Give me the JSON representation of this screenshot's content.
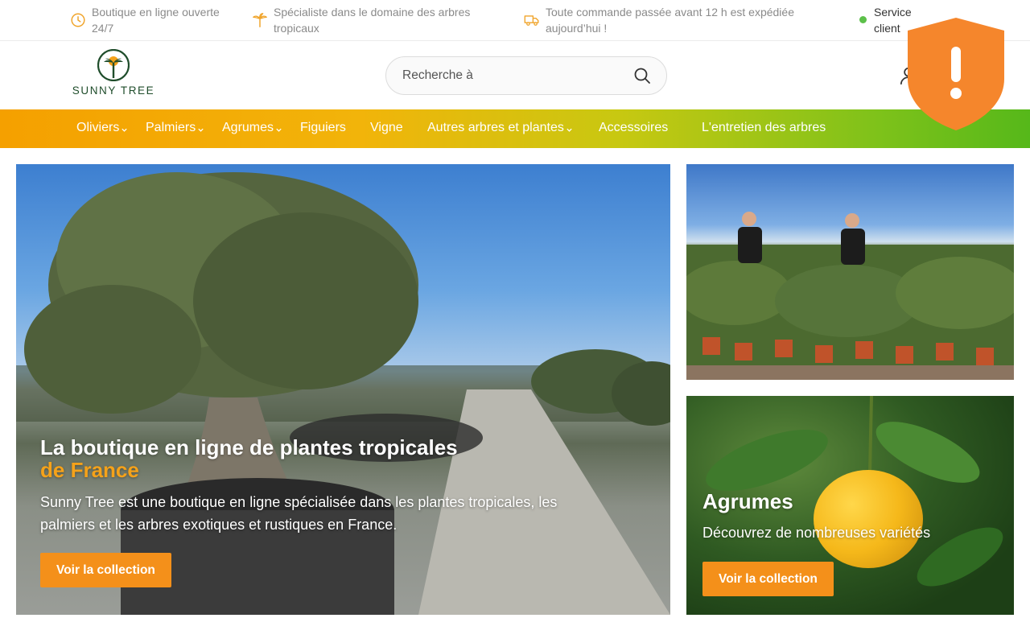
{
  "topbar": {
    "items": [
      {
        "icon": "clock-icon",
        "text": "Boutique en ligne ouverte 24/7"
      },
      {
        "icon": "palm-icon",
        "text": "Spécialiste dans le domaine des arbres tropicaux"
      },
      {
        "icon": "truck-icon",
        "text": "Toute commande passée avant 12 h est expédiée aujourd’hui !"
      },
      {
        "icon": "online-dot",
        "text": "Service client"
      }
    ]
  },
  "header": {
    "logo_text": "SUNNY TREE",
    "search_placeholder": "Recherche à"
  },
  "nav": {
    "items": [
      {
        "label": "Oliviers"
      },
      {
        "label": "Palmiers"
      },
      {
        "label": "Agrumes"
      },
      {
        "label": "Figuiers"
      },
      {
        "label": "Vigne"
      },
      {
        "label": "Autres arbres et plantes"
      },
      {
        "label": "Accessoires"
      },
      {
        "label": "L'entretien des arbres"
      }
    ]
  },
  "hero": {
    "title": "La boutique en ligne de plantes tropicales",
    "title_accent": "de France",
    "description": "Sunny Tree est une boutique en ligne spécialisée dans les plantes tropicales, les palmiers et les arbres exotiques et rustiques en France.",
    "button_label": "Voir la collection"
  },
  "card_agrumes": {
    "title": "Agrumes",
    "description": "Découvrez de nombreuses variétés",
    "button_label": "Voir la collection"
  },
  "colors": {
    "accent_orange": "#f4901a",
    "nav_start": "#f5a000",
    "nav_end": "#56b81a",
    "online_green": "#5cc04a",
    "shield_orange": "#f5862c"
  }
}
